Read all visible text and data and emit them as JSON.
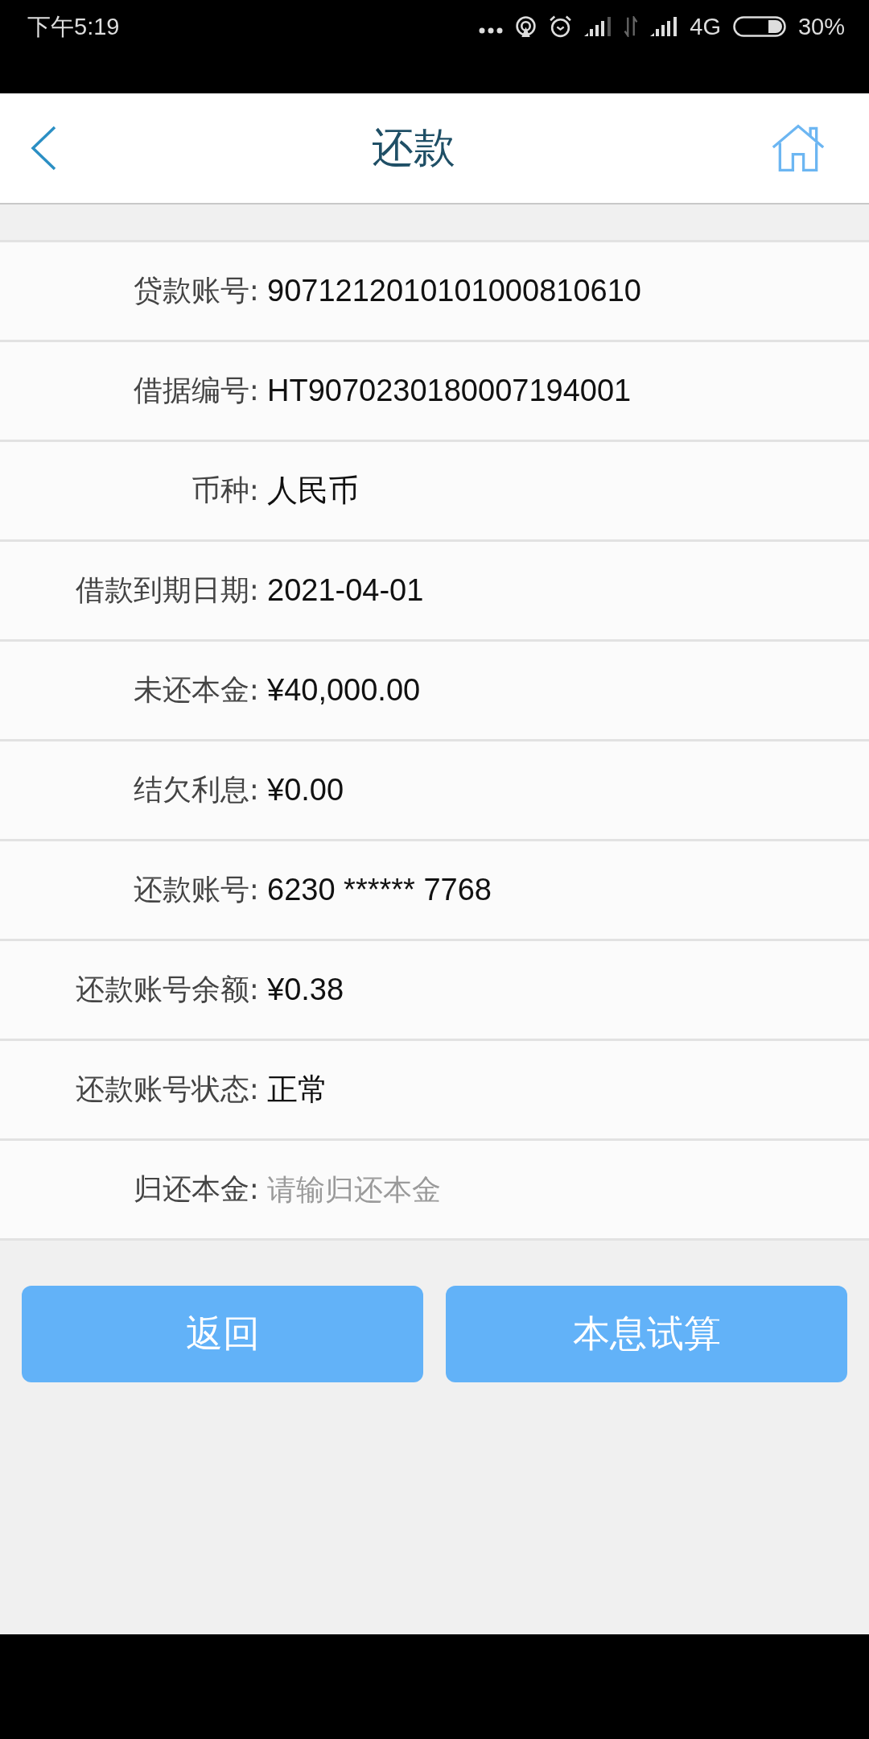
{
  "status_bar": {
    "time": "下午5:19",
    "network": "4G",
    "battery": "30%"
  },
  "header": {
    "title": "还款"
  },
  "fields": [
    {
      "kind": "text",
      "label": "贷款账号:",
      "value": "9071212010101000810610"
    },
    {
      "kind": "text",
      "label": "借据编号:",
      "value": "HT9070230180007194001"
    },
    {
      "kind": "text",
      "label": "币种:",
      "value": "人民币"
    },
    {
      "kind": "text",
      "label": "借款到期日期:",
      "value": "2021-04-01"
    },
    {
      "kind": "text",
      "label": "未还本金:",
      "value": "¥40,000.00"
    },
    {
      "kind": "text",
      "label": "结欠利息:",
      "value": "¥0.00"
    },
    {
      "kind": "text",
      "label": "还款账号:",
      "value": "6230 ****** 7768"
    },
    {
      "kind": "text",
      "label": "还款账号余额:",
      "value": "¥0.38"
    },
    {
      "kind": "text",
      "label": "还款账号状态:",
      "value": "正常"
    },
    {
      "kind": "input",
      "label": "归还本金:",
      "placeholder": "请输归还本金"
    }
  ],
  "buttons": [
    "返回",
    "本息试算"
  ]
}
